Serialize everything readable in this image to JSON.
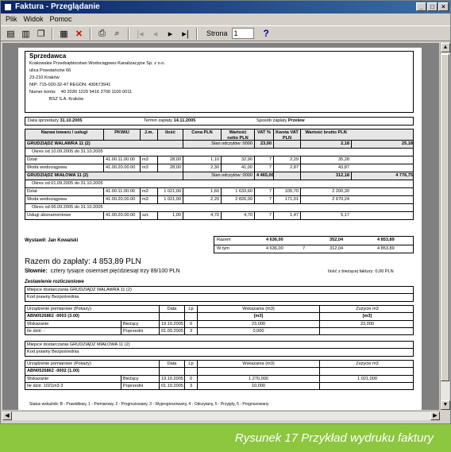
{
  "window": {
    "title": "Faktura - Przeglądanie",
    "buttons": [
      "_",
      "□",
      "×"
    ]
  },
  "menu": [
    "Plik",
    "Widok",
    "Pomoc"
  ],
  "toolbar": {
    "page_label": "Strona",
    "page_value": "1",
    "help": "?"
  },
  "invoice": {
    "seller_title": "Sprzedawca",
    "seller_lines": [
      "Krakowskie Przedsiębiorstwo Wodociągowo-Kanalizacyjne Sp. z o.o.",
      "ulica Powstańców 66",
      "23-210 Kraków",
      "NIP: 715-020-32-47 REGON: 430673941",
      "Numer konta:    40 2030 1229 5416 2700 1100 0011",
      "                BSZ S.A. Kraków"
    ],
    "dates": {
      "issue_label": "Data sprzedaży",
      "issue": "31.10.2005",
      "due_label": "Termin zapłaty",
      "due": "14.11.2005",
      "method_label": "Sposób zapłaty",
      "method": "Przelew"
    },
    "headers": [
      "Nazwa towaru / usługi",
      "PKWiU",
      "J.m.",
      "Ilość",
      "Cena PLN",
      "Wartość netto PLN",
      "VAT %",
      "Kwota VAT PLN",
      "Wartość brutto PLN"
    ],
    "groups": [
      {
        "name": "GRUDZIĄDZ WALAWRA 11 (2)",
        "stan": "Stan odczytów: 0000",
        "netto": "23,00",
        "vat": "2,18",
        "brutto": "25,18",
        "period": "Okres od 10.09.2005 do 31.10.2005",
        "rows": [
          {
            "n": "Dziat",
            "k": "41.00.11.00.00",
            "j": "m3",
            "i": "28,00",
            "c": "1,10",
            "w": "32,90",
            "v": "7",
            "kv": "2,29",
            "b": "35,28"
          },
          {
            "n": "Woda wodociągowa",
            "k": "41.00.20.00.00",
            "j": "m3",
            "i": "28,00",
            "c": "2,30",
            "w": "41,00",
            "v": "7",
            "kv": "2,87",
            "b": "43,87"
          }
        ]
      },
      {
        "name": "GRUDZIĄDZ MIAŁOWA 11 (2)",
        "stan": "Stan odczytów: 0000",
        "netto": "4 465,00",
        "vat": "312,18",
        "brutto": "4 776,75",
        "period": "Okres od 01.09.2005 do 31.10.2005",
        "rows": [
          {
            "n": "Dziat",
            "k": "41.00.11.00.00",
            "j": "m3",
            "i": "1 021,00",
            "c": "1,60",
            "w": "1 633,60",
            "v": "7",
            "kv": "105,70",
            "b": "2 200,30"
          },
          {
            "n": "Woda wodociągowa",
            "k": "41.00.20.00.00",
            "j": "m3",
            "i": "1 021,00",
            "c": "2,20",
            "w": "2 826,00",
            "v": "7",
            "kv": "171,01",
            "b": "2 670,24"
          }
        ],
        "period2": "Okres od 06.09.2005 do 31.10.2005",
        "rows2": [
          {
            "n": "Usługi abonamentowe",
            "k": "41.00.20.00.00",
            "j": "szt.",
            "i": "1,00",
            "c": "4,70",
            "w": "4,70",
            "v": "7",
            "kv": "1,47",
            "b": "5,17"
          }
        ]
      }
    ],
    "issuer_label": "Wystawił: Jan Kowalski",
    "totals": {
      "razem_label": "Razem",
      "razem_netto": "4 636,00",
      "razem_vat": "352,04",
      "razem_brutto": "4 853,89",
      "wtym_label": "W tym",
      "wtym_netto": "4 636,00",
      "wtym_v": "7",
      "wtym_vat": "312,04",
      "wtym_brutto": "4 853,89"
    },
    "to_pay": "Razem do zapłaty: 4 853,89 PLN",
    "words_label": "Słownie:",
    "words": "cztery tysiące osiemset pięćdziesiąt trzy 89/100 PLN",
    "invoice_count": "Ilość z bieżącej faktury: 0,00 PLN",
    "settlement_title": "Zestawienie rozliczeniowe",
    "s_blocks": [
      {
        "addr_label": "Miejsce dostarczania",
        "addr": "GRUDZIĄDZ WALAWRA 11 (2)",
        "payer_label": "Kod prawny",
        "payer": "Bezpośrednia",
        "hdr": [
          "Urządzenie pomiarowe (Pokazy)",
          "Data",
          "Lp",
          "Wskazania (m3)",
          "Zużycie m3"
        ],
        "meter": "ABN0526862 -0003 (3.00)",
        "lines": [
          [
            "Wskazanie",
            "Bieżący",
            "19.10.2005",
            "0",
            "23,000",
            "23,000"
          ],
          [
            "Ile dziś: -",
            "Poprzedni",
            "01.09.2005",
            "3",
            "0,000",
            ""
          ]
        ],
        "unit": "[m3]"
      },
      {
        "addr_label": "Miejsce dostarczania",
        "addr": "GRUDZIĄDZ MIAŁOWA 11 (2)",
        "payer_label": "Kod prawny",
        "payer": "Bezpośrednia",
        "hdr": [
          "Urządzenie pomiarowe (Pokazy)",
          "Data",
          "Lp",
          "Wskazania (m3)",
          "Zużycie m3"
        ],
        "meter": "ABN0526862 -0002 (1.00)",
        "lines": [
          [
            "Wskazanie",
            "Bieżący",
            "19.10.2005",
            "0",
            "1 270,000",
            "1 021,000"
          ],
          [
            "Ile dziś: 1021m3 3",
            "Poprzedni",
            "01.10.2005",
            "3",
            "10,000",
            ""
          ]
        ],
        "unit": ""
      }
    ],
    "footer": "Status wskaźnik: B - Prawidłowy, 1 - Pomiarowy, 2 - Prognozowany, 3 - Wyprognozowany, 4 - Odczytany, 5 - Przyjęty, 6 - Prognozowany"
  },
  "caption": "Rysunek 17 Przykład wydruku faktury",
  "colors": {
    "caption_bg": "#8dc63f",
    "title_bar": "#0a246a"
  }
}
